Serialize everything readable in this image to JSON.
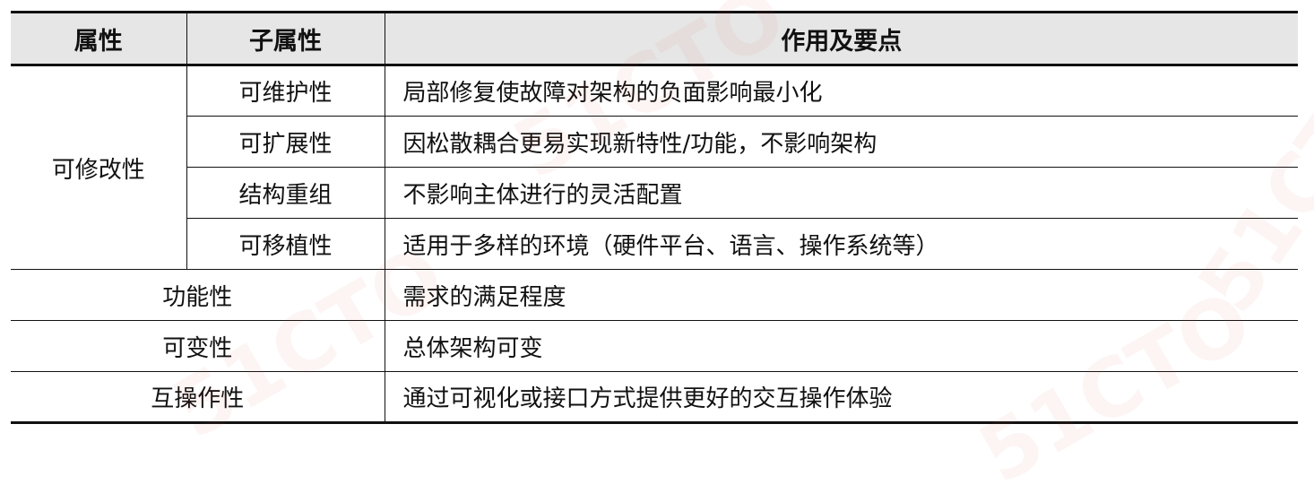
{
  "header": {
    "col1": "属性",
    "col2": "子属性",
    "col3": "作用及要点"
  },
  "group": {
    "attribute": "可修改性",
    "rows": [
      {
        "sub": "可维护性",
        "desc": "局部修复使故障对架构的负面影响最小化"
      },
      {
        "sub": "可扩展性",
        "desc": "因松散耦合更易实现新特性/功能，不影响架构"
      },
      {
        "sub": "结构重组",
        "desc": "不影响主体进行的灵活配置"
      },
      {
        "sub": "可移植性",
        "desc": "适用于多样的环境（硬件平台、语言、操作系统等）"
      }
    ]
  },
  "others": [
    {
      "attribute": "功能性",
      "desc": "需求的满足程度"
    },
    {
      "attribute": "可变性",
      "desc": "总体架构可变"
    },
    {
      "attribute": "互操作性",
      "desc": "通过可视化或接口方式提供更好的交互操作体验"
    }
  ],
  "watermark": "51CTO",
  "accent_color": "#d94a3a"
}
